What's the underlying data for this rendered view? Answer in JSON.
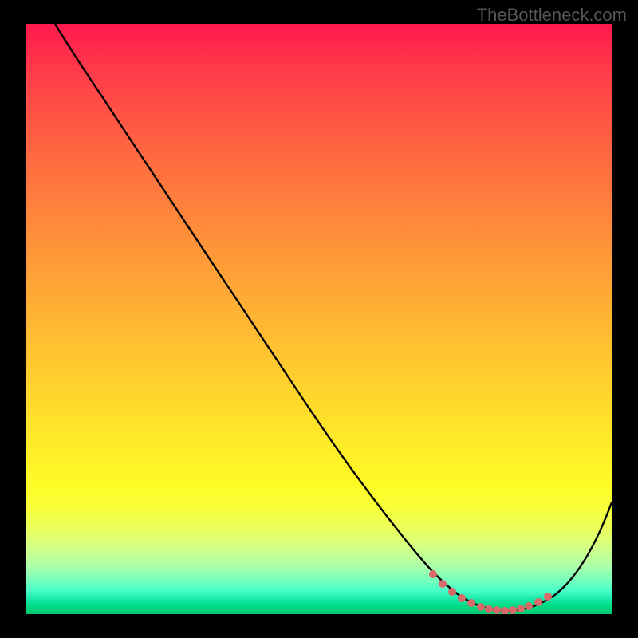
{
  "watermark": "TheBottleneck.com",
  "chart_data": {
    "type": "line",
    "title": "",
    "xlabel": "",
    "ylabel": "",
    "xlim": [
      0,
      100
    ],
    "ylim": [
      0,
      100
    ],
    "series": [
      {
        "name": "curve",
        "color": "#000000",
        "x": [
          5,
          10,
          15,
          20,
          25,
          30,
          35,
          40,
          45,
          50,
          55,
          60,
          65,
          70,
          75,
          80,
          82,
          85,
          90,
          95,
          100
        ],
        "values": [
          100,
          94,
          88,
          83,
          77,
          70,
          63,
          56,
          49,
          42,
          35,
          28,
          20,
          12,
          5.2,
          1.8,
          0.9,
          0.8,
          3.0,
          10,
          22
        ]
      },
      {
        "name": "highlight",
        "color": "#e26a6a",
        "x": [
          70,
          72,
          74,
          76,
          78,
          80,
          82,
          84,
          86,
          88
        ],
        "values": [
          12,
          8.5,
          5.5,
          3.5,
          2.2,
          1.5,
          1.0,
          0.8,
          1.2,
          2.4
        ]
      }
    ],
    "gradient_stops": [
      {
        "pos": 0,
        "color": "#ff1a4d"
      },
      {
        "pos": 50,
        "color": "#ffb034"
      },
      {
        "pos": 80,
        "color": "#fffb26"
      },
      {
        "pos": 100,
        "color": "#00c870"
      }
    ]
  }
}
